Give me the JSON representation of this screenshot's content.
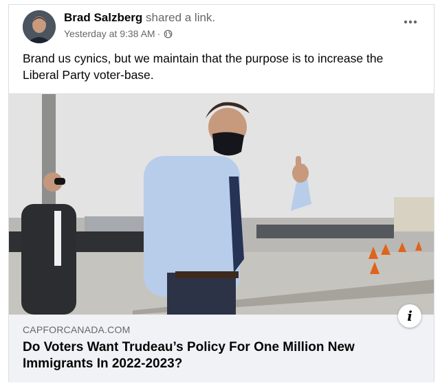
{
  "post": {
    "author": "Brad Salzberg",
    "action": "shared a link.",
    "timestamp": "Yesterday at 9:38 AM",
    "separator": "·",
    "audience_icon": "public-globe-icon",
    "more_icon": "more-options-icon",
    "text": "Brand us cynics, but we maintain that the purpose is to increase the Liberal Party voter-base."
  },
  "link": {
    "domain": "CAPFORCANADA.COM",
    "title": "Do Voters Want Trudeau’s Policy For One Million New Immigrants In 2022-2023?",
    "info_icon": "info-icon",
    "info_glyph": "i"
  },
  "colors": {
    "primary_text": "#050505",
    "secondary_text": "#65676b",
    "card_background": "#f0f2f5",
    "border": "#dadde1"
  }
}
